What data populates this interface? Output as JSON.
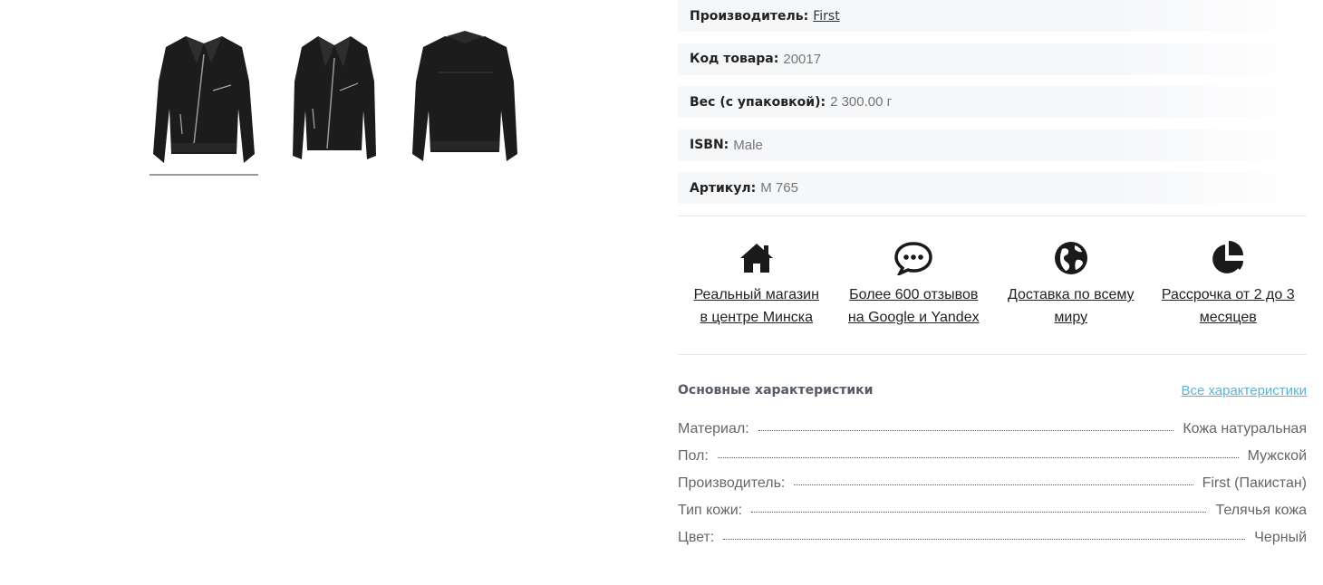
{
  "gallery": {
    "thumbnails": [
      {
        "alt": "front-zipped",
        "active": true
      },
      {
        "alt": "front-open",
        "active": false
      },
      {
        "alt": "back",
        "active": false
      }
    ]
  },
  "properties": [
    {
      "label": "Производитель:",
      "value": "First",
      "link": true
    },
    {
      "label": "Код товара:",
      "value": "20017",
      "link": false
    },
    {
      "label": "Вес (с упаковкой):",
      "value": "2 300.00 г",
      "link": false
    },
    {
      "label": "ISBN:",
      "value": "Male",
      "link": false
    },
    {
      "label": "Артикул:",
      "value": "М 765",
      "link": false
    }
  ],
  "benefits": [
    {
      "icon": "home-icon",
      "text": "Реальный магазин в центре Минска"
    },
    {
      "icon": "chat-icon",
      "text": "Более 600 отзывов на Google и Yandex"
    },
    {
      "icon": "globe-icon",
      "text": "Доставка по всему миру"
    },
    {
      "icon": "pie-chart-icon",
      "text": "Рассрочка от 2 до 3 месяцев"
    }
  ],
  "specs": {
    "title": "Основные характеристики",
    "all_link": "Все характеристики",
    "rows": [
      {
        "name": "Материал:",
        "value": "Кожа натуральная"
      },
      {
        "name": "Пол:",
        "value": "Мужской"
      },
      {
        "name": "Производитель:",
        "value": "First (Пакистан)"
      },
      {
        "name": "Тип кожи:",
        "value": "Телячья кожа"
      },
      {
        "name": "Цвет:",
        "value": "Черный"
      }
    ]
  },
  "colors": {
    "accent_link": "#5ab4d6",
    "row_bg": "#f6f7f9"
  }
}
